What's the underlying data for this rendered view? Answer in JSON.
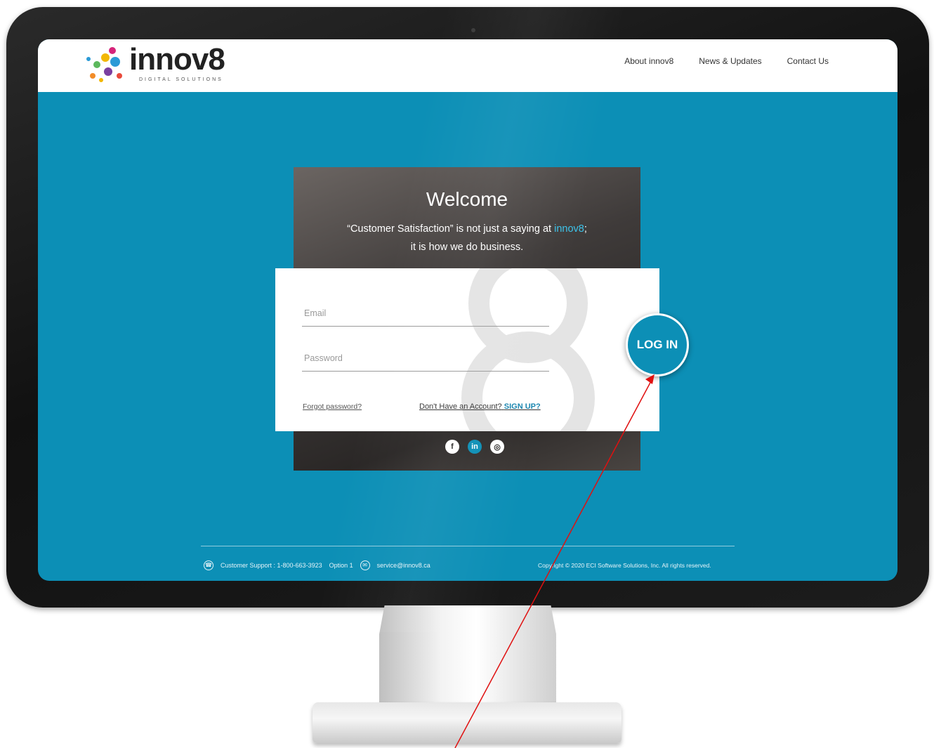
{
  "header": {
    "logo_text": "innov8",
    "logo_tagline": "DIGITAL SOLUTIONS",
    "nav": [
      {
        "label": "About innov8"
      },
      {
        "label": "News & Updates"
      },
      {
        "label": "Contact Us"
      }
    ]
  },
  "login": {
    "title": "Welcome",
    "tagline_pre": "“Customer Satisfaction” is not just a saying at ",
    "tagline_brand": "innov8",
    "tagline_post": ";",
    "tagline_line2": "it is how we do business.",
    "email_placeholder": "Email",
    "password_placeholder": "Password",
    "forgot_label": "Forgot password?",
    "signup_prefix": "Don't Have an Account?",
    "signup_cta": "SIGN UP?",
    "login_label": "LOG IN"
  },
  "socials": [
    {
      "icon": "facebook-icon",
      "glyph": "f"
    },
    {
      "icon": "linkedin-icon",
      "glyph": "in"
    },
    {
      "icon": "instagram-icon",
      "glyph": "◎"
    }
  ],
  "footer": {
    "support_label": "Customer Support : 1-800-663-3923",
    "support_option": "Option 1",
    "email": "service@innov8.ca",
    "copyright": "Copyright © 2020 ECI Software Solutions, Inc. All rights reserved."
  },
  "colors": {
    "accent": "#0c8fb6",
    "brand_highlight": "#3cc3ea",
    "annotation_arrow": "#e01010"
  }
}
